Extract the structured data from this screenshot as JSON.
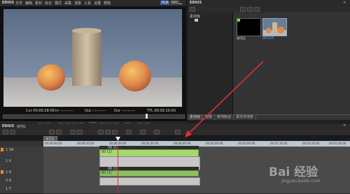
{
  "app": {
    "name": "EDIUS",
    "menu": [
      "文件",
      "编辑",
      "素材",
      "标记",
      "模式",
      "采集",
      "渲染",
      "工具",
      "设置",
      "帮助"
    ],
    "mode_badge": "PLR",
    "mode_badge2": "REC"
  },
  "player": {
    "timecodes": {
      "cur": "Cur 00:00:28:09",
      "in": "In --:--:--:--",
      "out": "Out --:--:--:--",
      "dur": "Dur --:--:--:--",
      "ttl": "TTL 00:00:10:00"
    }
  },
  "bin": {
    "title": "EDIUS",
    "header_label": "素材库",
    "clip1_label": "序列1",
    "clip2_label": "00103",
    "tabs": [
      "素材库",
      "特效",
      "序列标记",
      "源文件浏览"
    ]
  },
  "timeline": {
    "title": "EDIUS",
    "sequence_name": "序列1",
    "sequence_tab": "序列1",
    "ruler_labels": [
      "00:00:00:00",
      "00:00:10:00",
      "00:00:20:00",
      "00:00:30:00",
      "00:00:40:00",
      "00:00:50:00",
      "00:01:00:00",
      "00:01:10:00",
      "00:01:20:00",
      "00:01:30:00"
    ],
    "tracks": [
      {
        "name": "1 VA"
      },
      {
        "name": "1 V"
      },
      {
        "name": "1 A"
      },
      {
        "name": "2 A"
      },
      {
        "name": "1 T"
      }
    ],
    "clips": {
      "video_label": "00 (1)",
      "audio1_label": "00 (1)",
      "audio2_label": "00 (1)",
      "audio3_label": "00 (1)"
    }
  },
  "watermark": {
    "text": "Bai 经验",
    "sub": "jingyan.baidu.com"
  },
  "colors": {
    "accent": "#e03030",
    "clip": "#a6d86e",
    "orange": "#e09030"
  }
}
